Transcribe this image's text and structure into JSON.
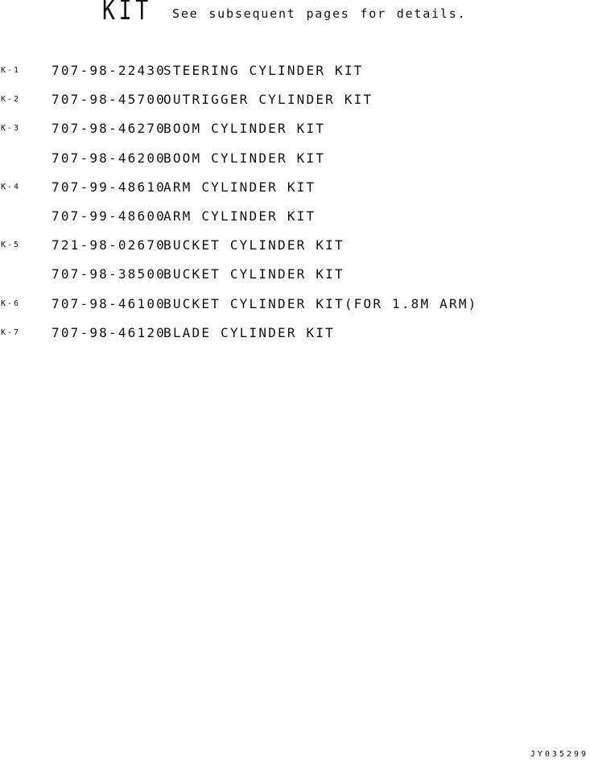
{
  "header": {
    "title": "KIT",
    "note": "See subsequent pages for details."
  },
  "kits": [
    {
      "item": "K-1",
      "part_no": "707-98-22430",
      "description": "STEERING CYLINDER KIT"
    },
    {
      "item": "K-2",
      "part_no": "707-98-45700",
      "description": "OUTRIGGER CYLINDER KIT"
    },
    {
      "item": "K-3",
      "part_no": "707-98-46270",
      "description": "BOOM CYLINDER KIT"
    },
    {
      "item": "",
      "part_no": "707-98-46200",
      "description": "BOOM CYLINDER KIT"
    },
    {
      "item": "K-4",
      "part_no": "707-99-48610",
      "description": "ARM CYLINDER KIT"
    },
    {
      "item": "",
      "part_no": "707-99-48600",
      "description": "ARM CYLINDER KIT"
    },
    {
      "item": "K-5",
      "part_no": "721-98-02670",
      "description": "BUCKET CYLINDER KIT"
    },
    {
      "item": "",
      "part_no": "707-98-38500",
      "description": "BUCKET CYLINDER KIT"
    },
    {
      "item": "K-6",
      "part_no": "707-98-46100",
      "description": "BUCKET CYLINDER KIT(FOR 1.8M ARM)"
    },
    {
      "item": "K-7",
      "part_no": "707-98-46120",
      "description": "BLADE CYLINDER KIT"
    }
  ],
  "footer": {
    "code": "JY035299"
  }
}
